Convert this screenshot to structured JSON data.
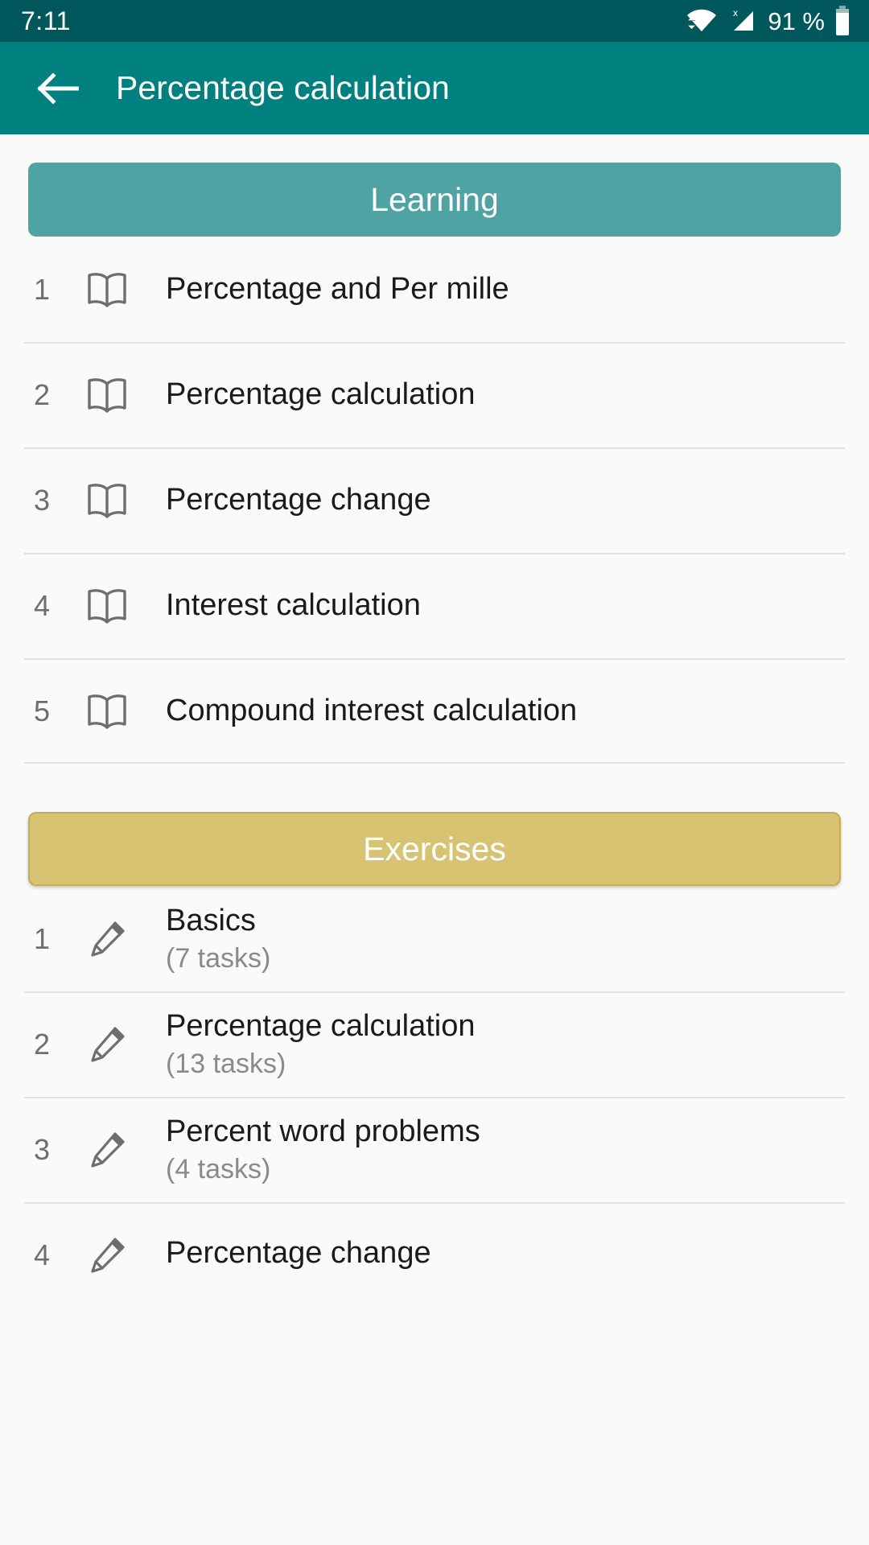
{
  "status_bar": {
    "clock": "7:11",
    "battery_text": "91 %",
    "wifi_icon": "wifi-icon",
    "signal_icon": "cellular-no-sim-icon",
    "battery_icon": "battery-icon",
    "background_color": "#00585C"
  },
  "app_bar": {
    "title": "Percentage calculation",
    "back_icon": "back-arrow-icon",
    "background_color": "#00807F"
  },
  "sections": [
    {
      "header_label": "Learning",
      "header_color": "#4FA3A3",
      "item_icon": "book-icon",
      "items": [
        {
          "index": "1",
          "title": "Percentage and Per mille",
          "subtitle": ""
        },
        {
          "index": "2",
          "title": "Percentage calculation",
          "subtitle": ""
        },
        {
          "index": "3",
          "title": "Percentage change",
          "subtitle": ""
        },
        {
          "index": "4",
          "title": "Interest calculation",
          "subtitle": ""
        },
        {
          "index": "5",
          "title": "Compound interest calculation",
          "subtitle": ""
        }
      ]
    },
    {
      "header_label": "Exercises",
      "header_color": "#D8C372",
      "item_icon": "pencil-icon",
      "items": [
        {
          "index": "1",
          "title": "Basics",
          "subtitle": "(7 tasks)"
        },
        {
          "index": "2",
          "title": "Percentage calculation",
          "subtitle": "(13 tasks)"
        },
        {
          "index": "3",
          "title": "Percent word problems",
          "subtitle": "(4 tasks)"
        },
        {
          "index": "4",
          "title": "Percentage change",
          "subtitle": ""
        }
      ]
    }
  ]
}
